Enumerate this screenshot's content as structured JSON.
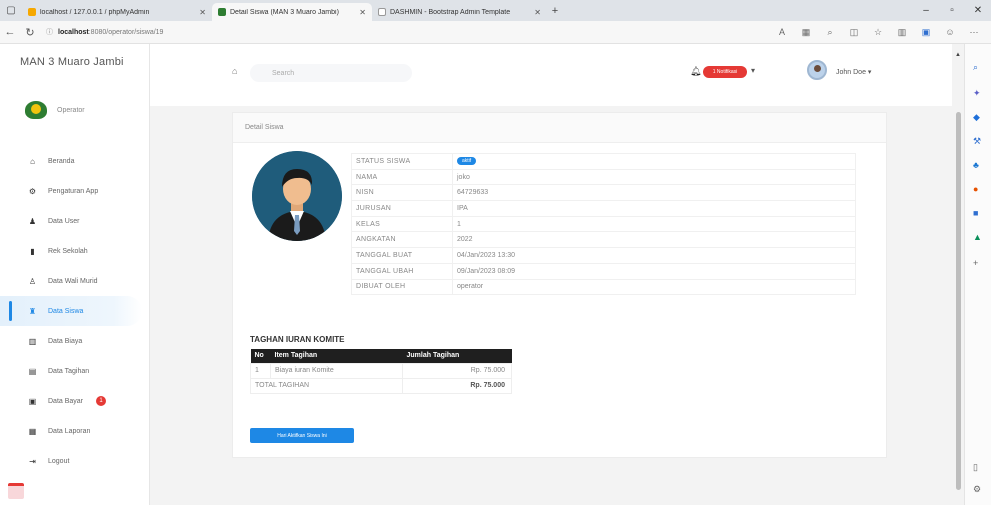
{
  "browser": {
    "tabs": [
      {
        "title": "localhost / 127.0.0.1 / phpMyAdmin",
        "color": "#f6a800",
        "active": false
      },
      {
        "title": "Detail Siswa (MAN 3 Muaro Jambi)",
        "color": "#2e7d32",
        "active": true
      },
      {
        "title": "DASHMIN - Bootstrap Admin Template",
        "color": "#999999",
        "active": false
      }
    ],
    "url_host": "localhost",
    "url_path": ":8080/operator/siswa/19"
  },
  "sidebar": {
    "brand": "MAN 3 Muaro Jambi",
    "username": "Operator",
    "items": [
      {
        "label": "Beranda",
        "icon": "home-icon",
        "glyph": "⌂"
      },
      {
        "label": "Pengaturan App",
        "icon": "gear-icon",
        "glyph": "⚙"
      },
      {
        "label": "Data User",
        "icon": "user-icon",
        "glyph": "♟"
      },
      {
        "label": "Rek Sekolah",
        "icon": "bank-icon",
        "glyph": "▮"
      },
      {
        "label": "Data Wali Murid",
        "icon": "person-icon",
        "glyph": "♙"
      },
      {
        "label": "Data Siswa",
        "icon": "graduate-icon",
        "glyph": "♜",
        "active": true
      },
      {
        "label": "Data Biaya",
        "icon": "chart-icon",
        "glyph": "▥"
      },
      {
        "label": "Data Tagihan",
        "icon": "invoice-icon",
        "glyph": "▤"
      },
      {
        "label": "Data Bayar",
        "icon": "money-icon",
        "glyph": "▣",
        "badge": "1"
      },
      {
        "label": "Data Laporan",
        "icon": "report-icon",
        "glyph": "▦"
      },
      {
        "label": "Logout",
        "icon": "logout-icon",
        "glyph": "⇥"
      }
    ]
  },
  "topbar": {
    "search_placeholder": "Search",
    "notif_label": "1 Notifikasi",
    "user_name": "John Doe"
  },
  "card": {
    "header": "Detail Siswa",
    "details": [
      {
        "key": "STATUS SISWA",
        "value": "aktif",
        "pill": true
      },
      {
        "key": "NAMA",
        "value": "joko"
      },
      {
        "key": "NISN",
        "value": "64729633"
      },
      {
        "key": "JURUSAN",
        "value": "IPA"
      },
      {
        "key": "KELAS",
        "value": "1"
      },
      {
        "key": "ANGKATAN",
        "value": "2022"
      },
      {
        "key": "TANGGAL BUAT",
        "value": "04/Jan/2023 13:30"
      },
      {
        "key": "TANGGAL UBAH",
        "value": "09/Jan/2023 08:09"
      },
      {
        "key": "DIBUAT OLEH",
        "value": "operator"
      }
    ],
    "tagihan_title": "TAGHAN IURAN KOMITE",
    "tagihan_headers": [
      "No",
      "Item Tagihan",
      "Jumlah Tagihan"
    ],
    "tagihan_rows": [
      {
        "no": "1",
        "item": "Biaya iuran Komite",
        "amount": "Rp. 75.000"
      }
    ],
    "total_label": "TOTAL TAGIHAN",
    "total_amount": "Rp. 75.000",
    "print_button": "Hari Aktifkan Siswa Ini"
  }
}
